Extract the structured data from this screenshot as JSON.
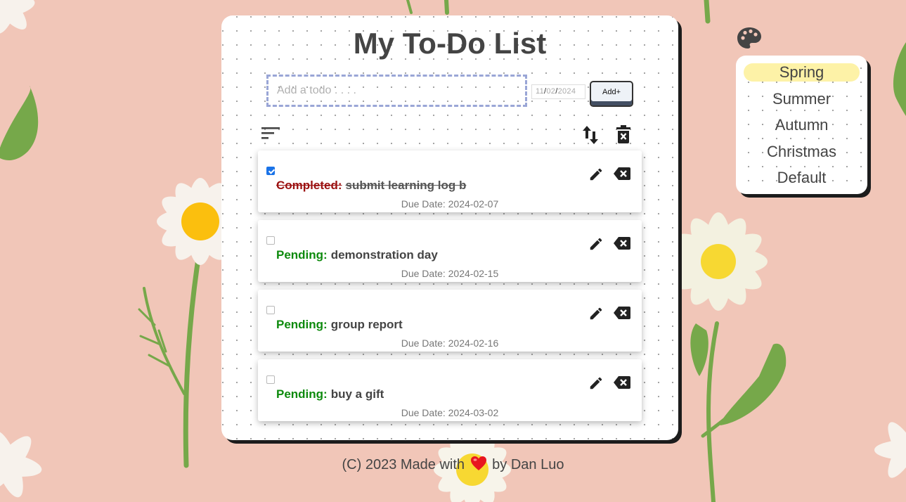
{
  "header": {
    "title": "My To-Do List"
  },
  "form": {
    "input_placeholder": "Add a todo . . . .",
    "input_value": "",
    "date": {
      "month": "11",
      "day": "02",
      "year": "2024",
      "separator": "/"
    },
    "add_label": "Add+"
  },
  "toolbar": {
    "filter_icon": "filter-list-icon",
    "sort_icon": "swap-vertical-icon",
    "delete_all_icon": "delete-forever-icon"
  },
  "todos": [
    {
      "checked": true,
      "status": "Completed:",
      "text": "submit learning log b",
      "due": "Due Date: 2024-02-07"
    },
    {
      "checked": false,
      "status": "Pending:",
      "text": "demonstration day",
      "due": "Due Date: 2024-02-15"
    },
    {
      "checked": false,
      "status": "Pending:",
      "text": "group report",
      "due": "Due Date: 2024-02-16"
    },
    {
      "checked": false,
      "status": "Pending:",
      "text": "buy a gift",
      "due": "Due Date: 2024-03-02"
    }
  ],
  "themes": {
    "icon": "palette-icon",
    "selected": "Spring",
    "items": [
      "Spring",
      "Summer",
      "Autumn",
      "Christmas",
      "Default"
    ]
  },
  "footer": {
    "prefix": "(C) 2023 Made with",
    "heart_icon": "heart-icon",
    "suffix": "by Dan Luo"
  },
  "colors": {
    "background": "#f1c6b8",
    "pending": "#0d8a0d",
    "completed": "#9b1111",
    "theme_highlight": "#fdf2a7",
    "input_border": "#9aa6d6"
  }
}
